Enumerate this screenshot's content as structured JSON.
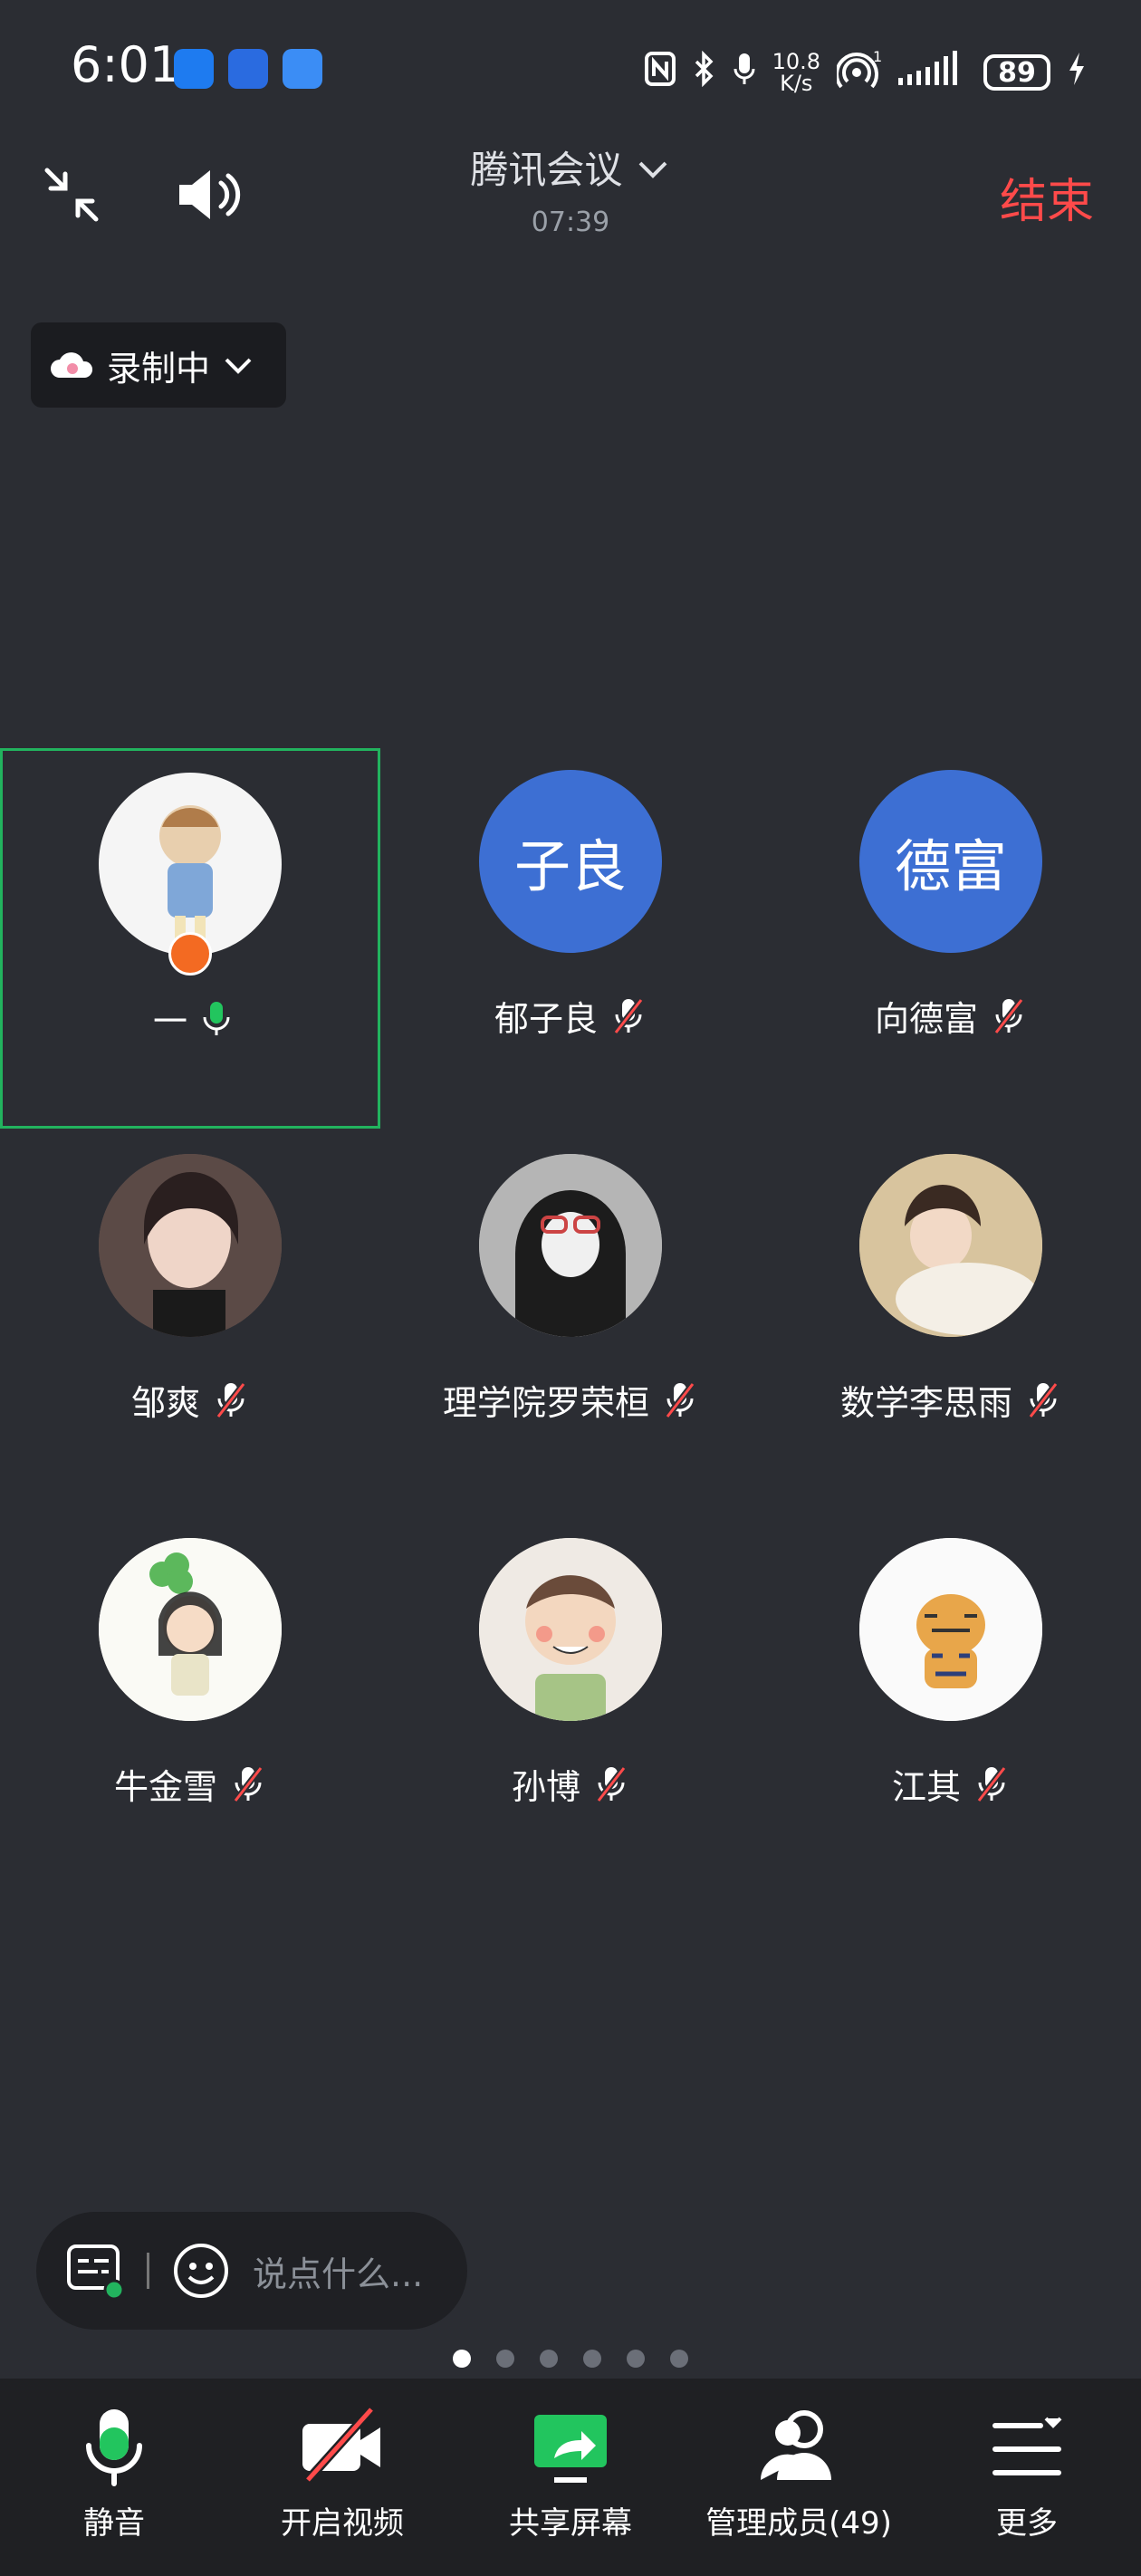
{
  "status_bar": {
    "time": "6:01",
    "net_speed_top": "10.8",
    "net_speed_bottom": "K/s",
    "signal_sup": "1",
    "battery": "89"
  },
  "header": {
    "title": "腾讯会议",
    "elapsed": "07:39",
    "end_label": "结束"
  },
  "recording": {
    "label": "录制中"
  },
  "participants": [
    {
      "name": "一",
      "avatar_text": "",
      "mic": "on",
      "host": true,
      "active": true
    },
    {
      "name": "郁子良",
      "avatar_text": "子良",
      "mic": "muted"
    },
    {
      "name": "向德富",
      "avatar_text": "德富",
      "mic": "muted"
    },
    {
      "name": "邹爽",
      "avatar_text": "",
      "mic": "muted"
    },
    {
      "name": "理学院罗荣桓",
      "avatar_text": "",
      "mic": "muted"
    },
    {
      "name": "数学李思雨",
      "avatar_text": "",
      "mic": "muted"
    },
    {
      "name": "牛金雪",
      "avatar_text": "",
      "mic": "muted"
    },
    {
      "name": "孙博",
      "avatar_text": "",
      "mic": "muted"
    },
    {
      "name": "江其",
      "avatar_text": "",
      "mic": "muted"
    }
  ],
  "chat": {
    "placeholder": "说点什么..."
  },
  "pager": {
    "count": 6,
    "current": 1
  },
  "toolbar": {
    "mute": "静音",
    "video": "开启视频",
    "share": "共享屏幕",
    "members": "管理成员(49)",
    "more": "更多"
  },
  "colors": {
    "end": "#ff4a4a",
    "accent_green": "#22b35e",
    "avatar_blue": "#3d6fd3"
  }
}
